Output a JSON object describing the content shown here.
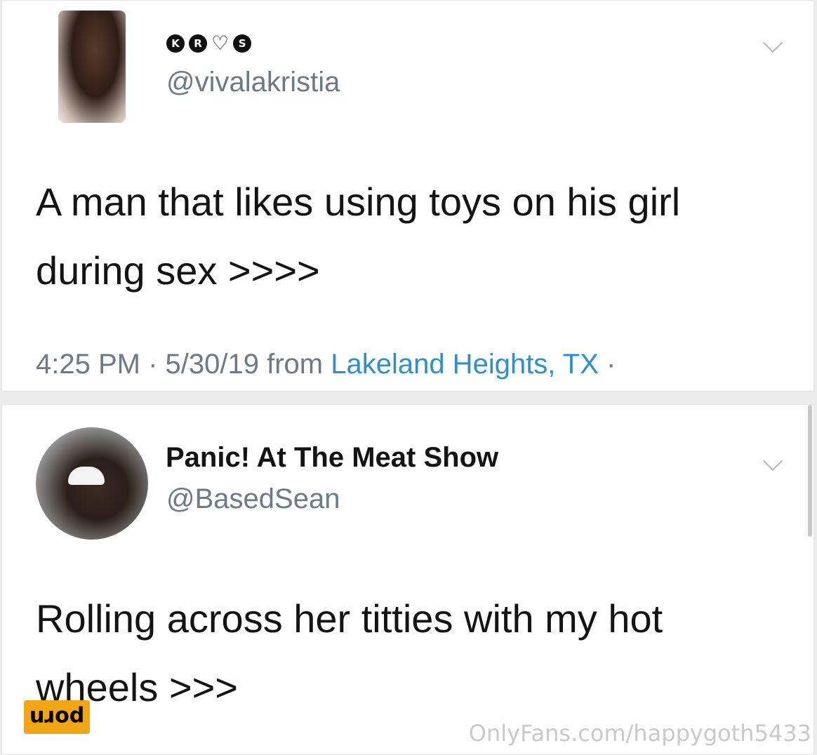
{
  "tweet1": {
    "handle": "@vivalakristia",
    "name_badges": [
      "K",
      "R",
      "♡",
      "S"
    ],
    "text_line1": "A man that likes using toys on his girl",
    "text_line2": "during sex >>>>",
    "time": "4:25 PM · 5/30/19 from ",
    "location": "Lakeland Heights, TX",
    "time_suffix": " ·"
  },
  "tweet2": {
    "display_name": "Panic! At The Meat Show",
    "handle": "@BasedSean",
    "text_line1": "Rolling across her titties with my hot",
    "text_line2": "wheels >>>"
  },
  "watermark": {
    "logo_text": "porn",
    "url": "OnlyFans.com/happygoth5433"
  }
}
